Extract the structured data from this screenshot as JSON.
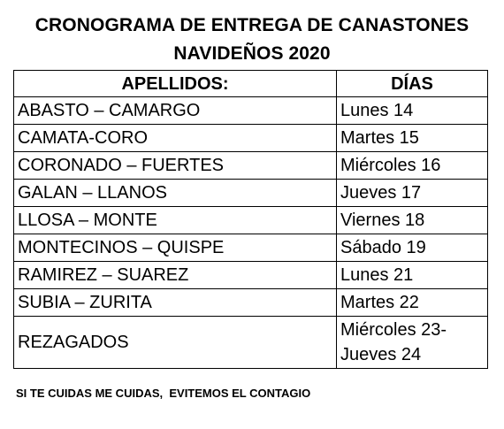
{
  "title_line1": "CRONOGRAMA DE ENTREGA DE CANASTONES",
  "title_line2": "NAVIDEÑOS 2020",
  "table": {
    "headers": [
      "APELLIDOS:",
      "DÍAS"
    ],
    "rows": [
      {
        "apellidos": "ABASTO – CAMARGO",
        "dias": "Lunes 14"
      },
      {
        "apellidos": "CAMATA-CORO",
        "dias": "Martes 15"
      },
      {
        "apellidos": "CORONADO – FUERTES",
        "dias": "Miércoles 16"
      },
      {
        "apellidos": "GALAN – LLANOS",
        "dias": "Jueves 17"
      },
      {
        "apellidos": "LLOSA – MONTE",
        "dias": "Viernes 18"
      },
      {
        "apellidos": "MONTECINOS – QUISPE",
        "dias": "Sábado 19"
      },
      {
        "apellidos": "RAMIREZ – SUAREZ",
        "dias": "Lunes 21"
      },
      {
        "apellidos": "SUBIA – ZURITA",
        "dias": "Martes 22"
      },
      {
        "apellidos": "REZAGADOS",
        "dias": "Miércoles 23-Jueves 24"
      }
    ]
  },
  "footer": "SI TE CUIDAS ME CUIDAS,  EVITEMOS EL CONTAGIO"
}
